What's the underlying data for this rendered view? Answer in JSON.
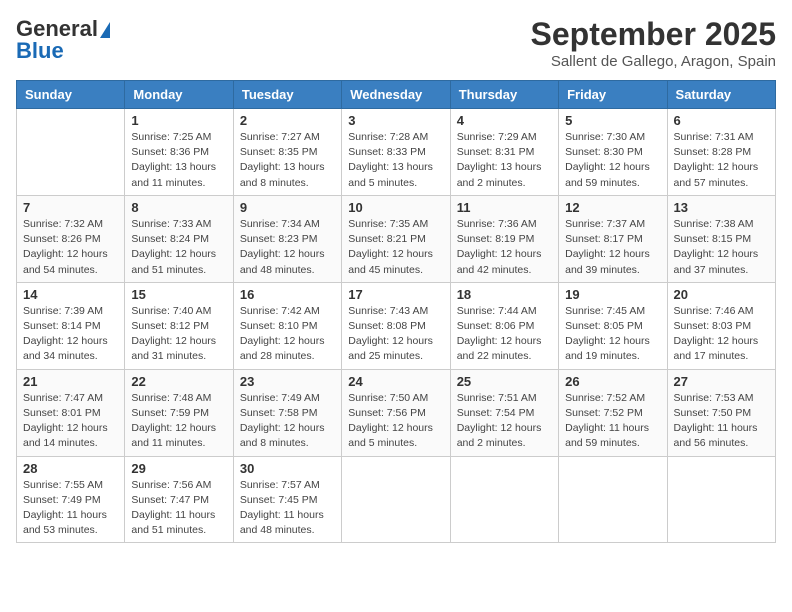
{
  "header": {
    "logo_general": "General",
    "logo_blue": "Blue",
    "title": "September 2025",
    "subtitle": "Sallent de Gallego, Aragon, Spain"
  },
  "days_of_week": [
    "Sunday",
    "Monday",
    "Tuesday",
    "Wednesday",
    "Thursday",
    "Friday",
    "Saturday"
  ],
  "weeks": [
    [
      {
        "day": "",
        "empty": true
      },
      {
        "day": "1",
        "sunrise": "Sunrise: 7:25 AM",
        "sunset": "Sunset: 8:36 PM",
        "daylight": "Daylight: 13 hours and 11 minutes."
      },
      {
        "day": "2",
        "sunrise": "Sunrise: 7:27 AM",
        "sunset": "Sunset: 8:35 PM",
        "daylight": "Daylight: 13 hours and 8 minutes."
      },
      {
        "day": "3",
        "sunrise": "Sunrise: 7:28 AM",
        "sunset": "Sunset: 8:33 PM",
        "daylight": "Daylight: 13 hours and 5 minutes."
      },
      {
        "day": "4",
        "sunrise": "Sunrise: 7:29 AM",
        "sunset": "Sunset: 8:31 PM",
        "daylight": "Daylight: 13 hours and 2 minutes."
      },
      {
        "day": "5",
        "sunrise": "Sunrise: 7:30 AM",
        "sunset": "Sunset: 8:30 PM",
        "daylight": "Daylight: 12 hours and 59 minutes."
      },
      {
        "day": "6",
        "sunrise": "Sunrise: 7:31 AM",
        "sunset": "Sunset: 8:28 PM",
        "daylight": "Daylight: 12 hours and 57 minutes."
      }
    ],
    [
      {
        "day": "7",
        "sunrise": "Sunrise: 7:32 AM",
        "sunset": "Sunset: 8:26 PM",
        "daylight": "Daylight: 12 hours and 54 minutes."
      },
      {
        "day": "8",
        "sunrise": "Sunrise: 7:33 AM",
        "sunset": "Sunset: 8:24 PM",
        "daylight": "Daylight: 12 hours and 51 minutes."
      },
      {
        "day": "9",
        "sunrise": "Sunrise: 7:34 AM",
        "sunset": "Sunset: 8:23 PM",
        "daylight": "Daylight: 12 hours and 48 minutes."
      },
      {
        "day": "10",
        "sunrise": "Sunrise: 7:35 AM",
        "sunset": "Sunset: 8:21 PM",
        "daylight": "Daylight: 12 hours and 45 minutes."
      },
      {
        "day": "11",
        "sunrise": "Sunrise: 7:36 AM",
        "sunset": "Sunset: 8:19 PM",
        "daylight": "Daylight: 12 hours and 42 minutes."
      },
      {
        "day": "12",
        "sunrise": "Sunrise: 7:37 AM",
        "sunset": "Sunset: 8:17 PM",
        "daylight": "Daylight: 12 hours and 39 minutes."
      },
      {
        "day": "13",
        "sunrise": "Sunrise: 7:38 AM",
        "sunset": "Sunset: 8:15 PM",
        "daylight": "Daylight: 12 hours and 37 minutes."
      }
    ],
    [
      {
        "day": "14",
        "sunrise": "Sunrise: 7:39 AM",
        "sunset": "Sunset: 8:14 PM",
        "daylight": "Daylight: 12 hours and 34 minutes."
      },
      {
        "day": "15",
        "sunrise": "Sunrise: 7:40 AM",
        "sunset": "Sunset: 8:12 PM",
        "daylight": "Daylight: 12 hours and 31 minutes."
      },
      {
        "day": "16",
        "sunrise": "Sunrise: 7:42 AM",
        "sunset": "Sunset: 8:10 PM",
        "daylight": "Daylight: 12 hours and 28 minutes."
      },
      {
        "day": "17",
        "sunrise": "Sunrise: 7:43 AM",
        "sunset": "Sunset: 8:08 PM",
        "daylight": "Daylight: 12 hours and 25 minutes."
      },
      {
        "day": "18",
        "sunrise": "Sunrise: 7:44 AM",
        "sunset": "Sunset: 8:06 PM",
        "daylight": "Daylight: 12 hours and 22 minutes."
      },
      {
        "day": "19",
        "sunrise": "Sunrise: 7:45 AM",
        "sunset": "Sunset: 8:05 PM",
        "daylight": "Daylight: 12 hours and 19 minutes."
      },
      {
        "day": "20",
        "sunrise": "Sunrise: 7:46 AM",
        "sunset": "Sunset: 8:03 PM",
        "daylight": "Daylight: 12 hours and 17 minutes."
      }
    ],
    [
      {
        "day": "21",
        "sunrise": "Sunrise: 7:47 AM",
        "sunset": "Sunset: 8:01 PM",
        "daylight": "Daylight: 12 hours and 14 minutes."
      },
      {
        "day": "22",
        "sunrise": "Sunrise: 7:48 AM",
        "sunset": "Sunset: 7:59 PM",
        "daylight": "Daylight: 12 hours and 11 minutes."
      },
      {
        "day": "23",
        "sunrise": "Sunrise: 7:49 AM",
        "sunset": "Sunset: 7:58 PM",
        "daylight": "Daylight: 12 hours and 8 minutes."
      },
      {
        "day": "24",
        "sunrise": "Sunrise: 7:50 AM",
        "sunset": "Sunset: 7:56 PM",
        "daylight": "Daylight: 12 hours and 5 minutes."
      },
      {
        "day": "25",
        "sunrise": "Sunrise: 7:51 AM",
        "sunset": "Sunset: 7:54 PM",
        "daylight": "Daylight: 12 hours and 2 minutes."
      },
      {
        "day": "26",
        "sunrise": "Sunrise: 7:52 AM",
        "sunset": "Sunset: 7:52 PM",
        "daylight": "Daylight: 11 hours and 59 minutes."
      },
      {
        "day": "27",
        "sunrise": "Sunrise: 7:53 AM",
        "sunset": "Sunset: 7:50 PM",
        "daylight": "Daylight: 11 hours and 56 minutes."
      }
    ],
    [
      {
        "day": "28",
        "sunrise": "Sunrise: 7:55 AM",
        "sunset": "Sunset: 7:49 PM",
        "daylight": "Daylight: 11 hours and 53 minutes."
      },
      {
        "day": "29",
        "sunrise": "Sunrise: 7:56 AM",
        "sunset": "Sunset: 7:47 PM",
        "daylight": "Daylight: 11 hours and 51 minutes."
      },
      {
        "day": "30",
        "sunrise": "Sunrise: 7:57 AM",
        "sunset": "Sunset: 7:45 PM",
        "daylight": "Daylight: 11 hours and 48 minutes."
      },
      {
        "day": "",
        "empty": true
      },
      {
        "day": "",
        "empty": true
      },
      {
        "day": "",
        "empty": true
      },
      {
        "day": "",
        "empty": true
      }
    ]
  ]
}
